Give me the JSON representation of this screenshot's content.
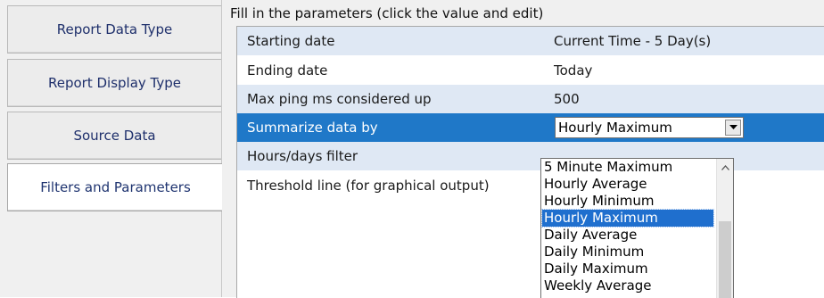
{
  "tabs": [
    {
      "label": "Report Data Type",
      "active": false
    },
    {
      "label": "Report Display Type",
      "active": false
    },
    {
      "label": "Source Data",
      "active": false
    },
    {
      "label": "Filters and Parameters",
      "active": true
    }
  ],
  "parameters": {
    "instructions": "Fill in the parameters (click the value and edit)",
    "rows": [
      {
        "label": "Starting date",
        "value": "Current Time - 5 Day(s)"
      },
      {
        "label": "Ending date",
        "value": "Today"
      },
      {
        "label": "Max ping ms considered up",
        "value": "500"
      },
      {
        "label": "Summarize data by",
        "value": "Hourly Maximum"
      },
      {
        "label": "Hours/days filter",
        "value": ""
      },
      {
        "label": "Threshold line (for graphical output)",
        "value": ""
      }
    ]
  },
  "dropdown": {
    "selected": "Hourly Maximum",
    "options": [
      "5 Minute Maximum",
      "Hourly Average",
      "Hourly Minimum",
      "Hourly Maximum",
      "Daily Average",
      "Daily Minimum",
      "Daily Maximum",
      "Weekly Average"
    ]
  },
  "colors": {
    "selected_row": "#1f78c8",
    "alt_row": "#dfe8f4",
    "tab_text": "#1e2f6b"
  }
}
